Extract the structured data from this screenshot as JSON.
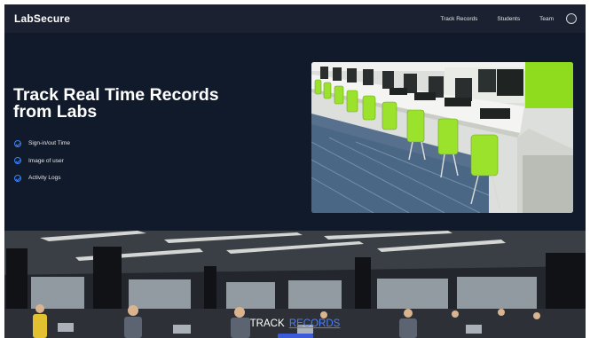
{
  "nav": {
    "brand": "LabSecure",
    "links": [
      "Track Records",
      "Students",
      "Team"
    ]
  },
  "hero": {
    "title": "Track Real Time Records from Labs",
    "features": [
      "Sign-in/out Time",
      "Image of user",
      "Activity Logs"
    ]
  },
  "banner": {
    "caption_word1": "TRACK",
    "caption_word2": "RECORDS"
  },
  "colors": {
    "background": "#111827",
    "nav": "#1b2130",
    "accent": "#3b82f6",
    "chair_green": "#9be22d"
  },
  "icons": [
    "check-circle-icon",
    "avatar-icon"
  ]
}
